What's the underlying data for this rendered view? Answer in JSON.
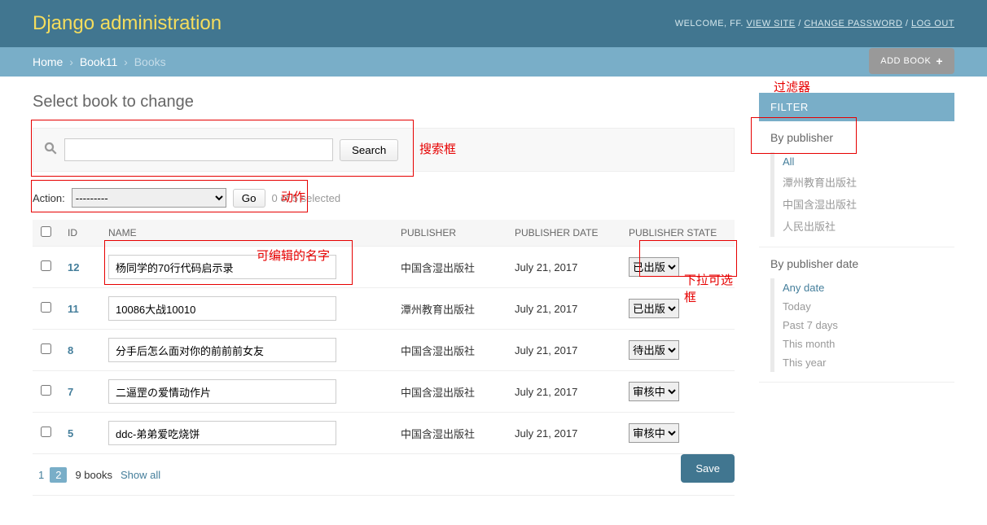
{
  "header": {
    "site_title": "Django administration",
    "welcome": "WELCOME, FF.",
    "view_site": "VIEW SITE",
    "change_password": "CHANGE PASSWORD",
    "logout": "LOG OUT"
  },
  "breadcrumbs": {
    "home": "Home",
    "app": "Book11",
    "model": "Books"
  },
  "page": {
    "title": "Select book to change",
    "add_button": "ADD BOOK",
    "search_button": "Search",
    "action_label": "Action:",
    "action_placeholder": "---------",
    "go_button": "Go",
    "selected_text": "0 of 5 selected",
    "save_button": "Save",
    "show_all": "Show all",
    "book_count": "9 books"
  },
  "columns": {
    "id": "ID",
    "name": "NAME",
    "publisher": "PUBLISHER",
    "pub_date": "PUBLISHER DATE",
    "pub_state": "PUBLISHER STATE"
  },
  "rows": [
    {
      "id": "12",
      "name": "杨同学的70行代码启示录",
      "publisher": "中国含湿出版社",
      "date": "July 21, 2017",
      "state": "已出版"
    },
    {
      "id": "11",
      "name": "10086大战10010",
      "publisher": "潭州教育出版社",
      "date": "July 21, 2017",
      "state": "已出版"
    },
    {
      "id": "8",
      "name": "分手后怎么面对你的前前前女友",
      "publisher": "中国含湿出版社",
      "date": "July 21, 2017",
      "state": "待出版"
    },
    {
      "id": "7",
      "name": "二逼罡の爱情动作片",
      "publisher": "中国含湿出版社",
      "date": "July 21, 2017",
      "state": "审核中"
    },
    {
      "id": "5",
      "name": "ddc-弟弟爱吃烧饼",
      "publisher": "中国含湿出版社",
      "date": "July 21, 2017",
      "state": "审核中"
    }
  ],
  "pagination": {
    "pages": [
      "1",
      "2"
    ],
    "current": "2"
  },
  "filter": {
    "title": "FILTER",
    "by_publisher": {
      "heading": "By publisher",
      "items": [
        "All",
        "潭州教育出版社",
        "中国含湿出版社",
        "人民出版社"
      ],
      "selected": 0
    },
    "by_date": {
      "heading": "By publisher date",
      "items": [
        "Any date",
        "Today",
        "Past 7 days",
        "This month",
        "This year"
      ],
      "selected": 0
    }
  },
  "annotations": {
    "filter": "过滤器",
    "search": "搜索框",
    "action": "动作",
    "editable_name": "可编辑的名字",
    "dropdown": "下拉可选框"
  }
}
